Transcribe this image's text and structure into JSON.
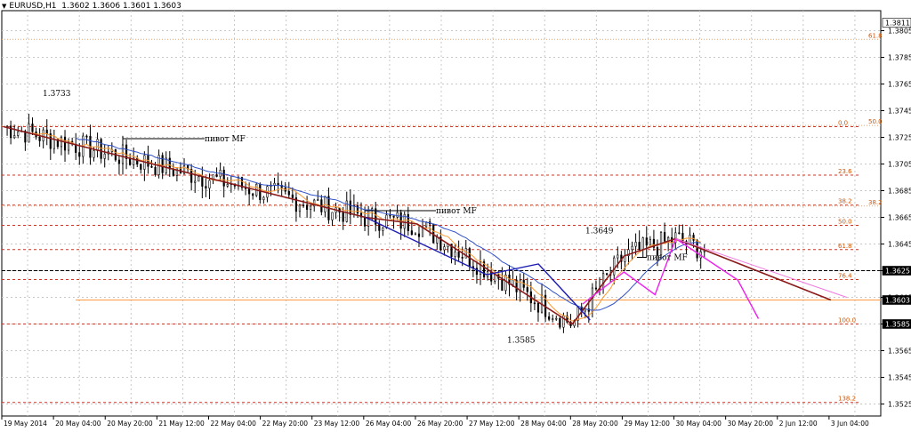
{
  "header": {
    "symbol": "EURUSD,H1",
    "ohlc": "1.3602 1.3606 1.3601 1.3603"
  },
  "chart_data": {
    "type": "candlestick",
    "symbol": "EURUSD",
    "timeframe": "H1",
    "ohlc_last": {
      "open": 1.3602,
      "high": 1.3606,
      "low": 1.3601,
      "close": 1.3603
    },
    "ylim": [
      1.3516,
      1.382
    ],
    "price_ticks": [
      "1.3805",
      "1.3785",
      "1.3765",
      "1.3745",
      "1.3725",
      "1.3705",
      "1.3685",
      "1.3665",
      "1.3645",
      "1.3625",
      "1.3605",
      "1.3585",
      "1.3565",
      "1.3545",
      "1.3525"
    ],
    "price_boxes": [
      {
        "value": "1.3811",
        "color": "#ffffff",
        "text_color": "#000000"
      },
      {
        "value": "1.3625",
        "color": "#000000",
        "text_color": "#ffffff"
      },
      {
        "value": "1.3603",
        "color": "#000000",
        "text_color": "#ffffff"
      },
      {
        "value": "1.3585",
        "color": "#000000",
        "text_color": "#ffffff"
      }
    ],
    "time_labels": [
      "19 May 2014",
      "20 May 04:00",
      "20 May 20:00",
      "21 May 12:00",
      "22 May 04:00",
      "22 May 20:00",
      "23 May 12:00",
      "26 May 04:00",
      "26 May 20:00",
      "27 May 12:00",
      "28 May 04:00",
      "28 May 20:00",
      "29 May 12:00",
      "30 May 04:00",
      "30 May 20:00",
      "2 Jun 12:00",
      "3 Jun 04:00"
    ],
    "fib_levels_left": [
      {
        "label": "0.0",
        "price": 1.3733
      },
      {
        "label": "23.6",
        "price": 1.36967
      },
      {
        "label": "38.2",
        "price": 1.36742
      },
      {
        "label": "50.0",
        "price": 1.3659
      },
      {
        "label": "61.8",
        "price": 1.36408
      },
      {
        "label": "76.4",
        "price": 1.36183
      },
      {
        "label": "100.0",
        "price": 1.3585
      },
      {
        "label": "138.2",
        "price": 1.35262
      }
    ],
    "fib_levels_right": [
      {
        "label": "61.8",
        "price": 1.37985
      },
      {
        "label": "50.0",
        "price": 1.37339
      },
      {
        "label": "38.2",
        "price": 1.36735
      }
    ],
    "horizontal_lines": [
      {
        "price": 1.3625,
        "color": "#000000",
        "style": "dashed"
      },
      {
        "price": 1.3603,
        "color": "#ff9a40",
        "style": "solid"
      }
    ],
    "annotations": [
      "1.3733",
      "1.3585",
      "1.3649",
      "пивот MF",
      "пивот MF",
      "пивот MF"
    ],
    "zigzag_main": [
      [
        0,
        1.3733
      ],
      [
        7,
        1.3665
      ],
      [
        8,
        1.366
      ],
      [
        11,
        1.3585
      ],
      [
        12,
        1.3636
      ],
      [
        13,
        1.3649
      ],
      [
        16,
        1.3603
      ]
    ],
    "grid": true,
    "background": "#ffffff",
    "colors": {
      "zigzag_main": "#8b1a1a",
      "zigzag_blue": "#1c1cb4",
      "zigzag_magenta": "#ee22ee",
      "ma_fast": "#ff9a30",
      "ma_slow": "#3050c8",
      "fib": "#c0392b",
      "fib_label": "#d35400"
    }
  }
}
